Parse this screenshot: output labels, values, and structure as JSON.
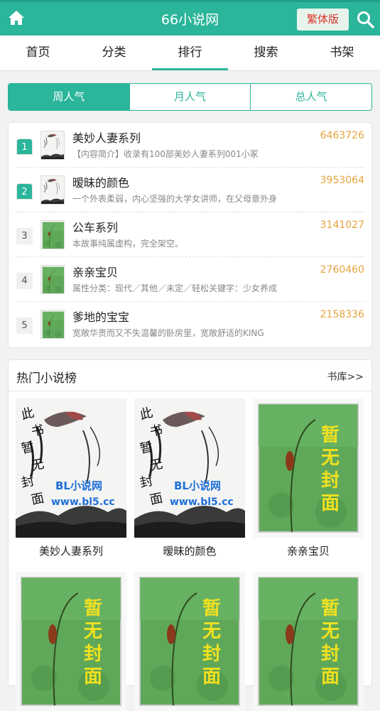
{
  "header": {
    "home_icon": "home-icon",
    "title": "66小说网",
    "trad_label": "繁体版",
    "search_icon": "search-icon",
    "accent": "#2bb59a"
  },
  "nav": {
    "items": [
      {
        "label": "首页"
      },
      {
        "label": "分类"
      },
      {
        "label": "排行"
      },
      {
        "label": "搜索"
      },
      {
        "label": "书架"
      }
    ],
    "active": "排行"
  },
  "rank_tabs": {
    "items": [
      {
        "label": "周人气"
      },
      {
        "label": "月人气"
      },
      {
        "label": "总人气"
      }
    ],
    "active": "周人气"
  },
  "rank_list": [
    {
      "rank": "1",
      "title": "美妙人妻系列",
      "count": "6463726",
      "desc": "【内容简介】收录有100部美妙人妻系列001小冢",
      "cover": "ink"
    },
    {
      "rank": "2",
      "title": "暧昧的颜色",
      "count": "3953064",
      "desc": "一个外表柔弱，内心坚强的大学女讲师，在父母意外身",
      "cover": "ink"
    },
    {
      "rank": "3",
      "title": "公车系列",
      "count": "3141027",
      "desc": "本故事纯属虚构，完全架空。",
      "cover": "green"
    },
    {
      "rank": "4",
      "title": "亲亲宝贝",
      "count": "2760460",
      "desc": "属性分类：现代／其他／未定／轻松关键字：少女养成",
      "cover": "green"
    },
    {
      "rank": "5",
      "title": "爹地的宝宝",
      "count": "2158336",
      "desc": "宽敞华贵而又不失温馨的卧房里，宽敞舒适的KING",
      "cover": "green"
    }
  ],
  "hot": {
    "title": "热门小说榜",
    "more": "书库>>",
    "cards": [
      {
        "title": "美妙人妻系列",
        "cover": "ink"
      },
      {
        "title": "暧昧的颜色",
        "cover": "ink"
      },
      {
        "title": "亲亲宝贝",
        "cover": "green"
      },
      {
        "title": "",
        "cover": "green"
      },
      {
        "title": "",
        "cover": "green"
      },
      {
        "title": "",
        "cover": "green"
      }
    ],
    "cover_text_ink_vertical": "此书暂无封面",
    "cover_text_ink_site": "BL小说网",
    "cover_text_ink_url": "www.bl5.cc",
    "cover_text_green": "暂无封面"
  }
}
